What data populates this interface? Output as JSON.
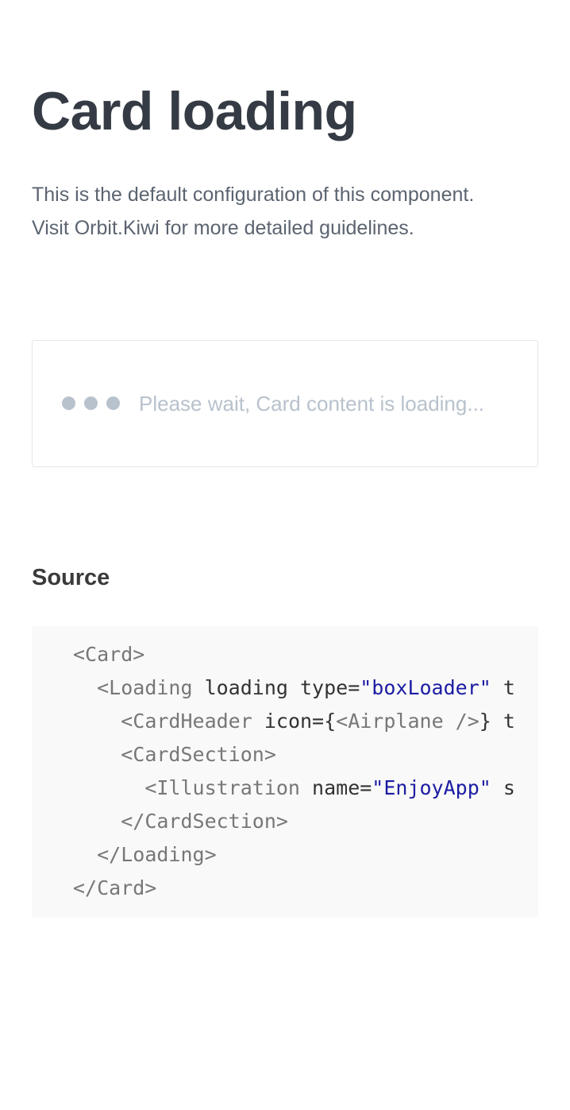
{
  "page": {
    "title": "Card loading",
    "description_line1": "This is the default configuration of this component.",
    "description_line2": "Visit Orbit.Kiwi for more detailed guidelines."
  },
  "card": {
    "loading_text": "Please wait, Card content is loading..."
  },
  "source": {
    "heading": "Source",
    "code_lines": [
      {
        "indent": "",
        "parts": [
          {
            "k": "tag",
            "t": "<Card>"
          }
        ]
      },
      {
        "indent": "  ",
        "parts": [
          {
            "k": "tag",
            "t": "<Loading"
          },
          {
            "k": "attr",
            "t": " loading type="
          },
          {
            "k": "str",
            "t": "\"boxLoader\""
          },
          {
            "k": "attr",
            "t": " t"
          }
        ]
      },
      {
        "indent": "    ",
        "parts": [
          {
            "k": "tag",
            "t": "<CardHeader"
          },
          {
            "k": "attr",
            "t": " icon={"
          },
          {
            "k": "tag",
            "t": "<Airplane />"
          },
          {
            "k": "attr",
            "t": "} t"
          }
        ]
      },
      {
        "indent": "    ",
        "parts": [
          {
            "k": "tag",
            "t": "<CardSection>"
          }
        ]
      },
      {
        "indent": "      ",
        "parts": [
          {
            "k": "tag",
            "t": "<Illustration"
          },
          {
            "k": "attr",
            "t": " name="
          },
          {
            "k": "str",
            "t": "\"EnjoyApp\""
          },
          {
            "k": "attr",
            "t": " s"
          }
        ]
      },
      {
        "indent": "    ",
        "parts": [
          {
            "k": "tag",
            "t": "</CardSection>"
          }
        ]
      },
      {
        "indent": "  ",
        "parts": [
          {
            "k": "tag",
            "t": "</Loading>"
          }
        ]
      },
      {
        "indent": "",
        "parts": [
          {
            "k": "tag",
            "t": "</Card>"
          }
        ]
      }
    ]
  },
  "colors": {
    "title": "#353b44",
    "description": "#5b6470",
    "loader": "#b8c2cd",
    "code_string": "#1c1ca3",
    "code_background": "#f9f9f9"
  }
}
